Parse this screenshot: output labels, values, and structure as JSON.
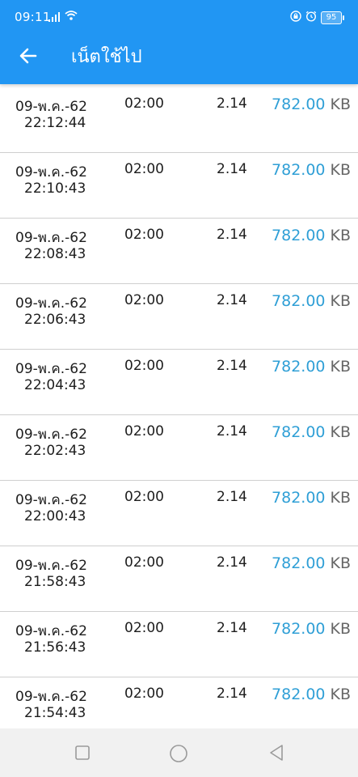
{
  "status_bar": {
    "time": "09:11",
    "battery": "95",
    "icons": [
      "signal-icon",
      "wifi-icon",
      "lock-icon",
      "alarm-icon",
      "battery-icon"
    ]
  },
  "app_bar": {
    "title": "เน็ตใช้ไป",
    "back_icon": "arrow-left-icon",
    "color": "#2196f3"
  },
  "usage_list": [
    {
      "date": "09-พ.ค.-62",
      "time": "22:12:44",
      "duration": "02:00",
      "amount": "2.14",
      "size": "782.00",
      "unit": "KB"
    },
    {
      "date": "09-พ.ค.-62",
      "time": "22:10:43",
      "duration": "02:00",
      "amount": "2.14",
      "size": "782.00",
      "unit": "KB"
    },
    {
      "date": "09-พ.ค.-62",
      "time": "22:08:43",
      "duration": "02:00",
      "amount": "2.14",
      "size": "782.00",
      "unit": "KB"
    },
    {
      "date": "09-พ.ค.-62",
      "time": "22:06:43",
      "duration": "02:00",
      "amount": "2.14",
      "size": "782.00",
      "unit": "KB"
    },
    {
      "date": "09-พ.ค.-62",
      "time": "22:04:43",
      "duration": "02:00",
      "amount": "2.14",
      "size": "782.00",
      "unit": "KB"
    },
    {
      "date": "09-พ.ค.-62",
      "time": "22:02:43",
      "duration": "02:00",
      "amount": "2.14",
      "size": "782.00",
      "unit": "KB"
    },
    {
      "date": "09-พ.ค.-62",
      "time": "22:00:43",
      "duration": "02:00",
      "amount": "2.14",
      "size": "782.00",
      "unit": "KB"
    },
    {
      "date": "09-พ.ค.-62",
      "time": "21:58:43",
      "duration": "02:00",
      "amount": "2.14",
      "size": "782.00",
      "unit": "KB"
    },
    {
      "date": "09-พ.ค.-62",
      "time": "21:56:43",
      "duration": "02:00",
      "amount": "2.14",
      "size": "782.00",
      "unit": "KB"
    },
    {
      "date": "09-พ.ค.-62",
      "time": "21:54:43",
      "duration": "02:00",
      "amount": "2.14",
      "size": "782.00",
      "unit": "KB"
    }
  ],
  "colors": {
    "size_value": "#2f9fd6",
    "unit": "#666666",
    "divider": "#cfcfcf",
    "nav_background": "#f1f1f1"
  },
  "nav_bar": {
    "buttons": [
      "square-icon",
      "circle-icon",
      "triangle-back-icon"
    ]
  }
}
